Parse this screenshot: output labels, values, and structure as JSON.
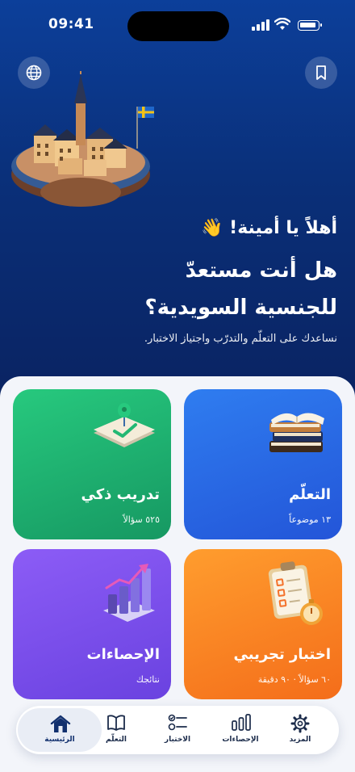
{
  "status_bar": {
    "time": "09:41"
  },
  "header": {
    "language_icon": "globe-icon",
    "bookmark_icon": "bookmark-icon"
  },
  "hero": {
    "greeting": "أهلاً يا أمينة! 👋",
    "heading_line1": "هل أنت مستعدّ",
    "heading_line2": "للجنسية السويدية؟",
    "subtitle": "نساعدك على التعلّم والتدرّب واجتياز الاختبار."
  },
  "cards": {
    "learn": {
      "title": "التعلّم",
      "meta": "١٣ موضوعاً",
      "color": "#2f6ee8"
    },
    "smart": {
      "title": "تدريب ذكي",
      "meta": "٥٢٥ سؤالاً",
      "color": "#22b873"
    },
    "exam": {
      "title": "اختبار تجريبي",
      "meta": "٦٠ سؤالاً · ٩٠ دقيقة",
      "color": "#f7841f"
    },
    "stats": {
      "title": "الإحصاءات",
      "meta": "نتائجك",
      "color": "#7b50ec"
    }
  },
  "tabbar": {
    "home": "الرئيسية",
    "learn": "التعلّم",
    "exam": "الاختبار",
    "stats": "الإحصاءات",
    "more": "المزيد"
  }
}
